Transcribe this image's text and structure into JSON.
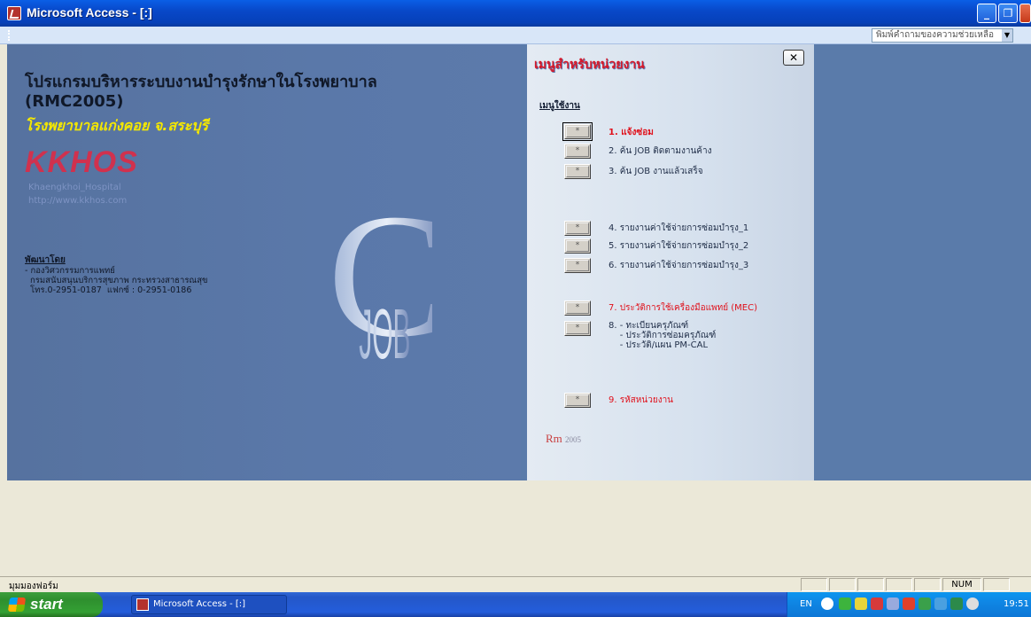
{
  "window": {
    "title": "Microsoft Access - [:]",
    "help_placeholder": "พิมพ์คำถามของความช่วยเหลือ",
    "minimize": "_",
    "maximize": "❐",
    "close": "✕"
  },
  "left": {
    "title_th": "โปรแกรมบริหารระบบงานบำรุงรักษาในโรงพยาบาล",
    "title_code": "(RMC2005)",
    "hospital": "โรงพยาบาลแก่งคอย จ.สระบุรี",
    "brand": "KKHOS",
    "brand_sub": "Khaengkhoi_Hospital",
    "brand_url": "http://www.kkhos.com",
    "dev_head": "พัฒนาโดย",
    "dev_lines": "- กองวิศวกรรมการแพทย์\n  กรมสนับสนุนบริการสุขภาพ กระทรวงสาธารณสุข\n  โทร.0-2951-0187  แฟกซ์ : 0-2951-0186",
    "cjob_letter": "C",
    "cjob_word": "JOB"
  },
  "menu": {
    "title": "เมนูสำหรับหน่วยงาน",
    "close": "✕",
    "subtitle": "เมนูใช้งาน",
    "button_glyph": "*",
    "items": [
      {
        "label": "1. แจ้งซ่อม"
      },
      {
        "label": "2. ค้น JOB ติดตามงานค้าง"
      },
      {
        "label": "3. ค้น JOB งานแล้วเสร็จ"
      },
      {
        "label": "4. รายงานค่าใช้จ่ายการซ่อมบำรุง_1"
      },
      {
        "label": "5. รายงานค่าใช้จ่ายการซ่อมบำรุง_2"
      },
      {
        "label": "6. รายงานค่าใช้จ่ายการซ่อมบำรุง_3"
      },
      {
        "label": "7. ประวัติการใช้เครื่องมือแพทย์ (MEC)"
      },
      {
        "label": "8. - ทะเบียนครุภัณฑ์\n    - ประวัติการซ่อมครุภัณฑ์\n    - ประวัติ/แผน PM-CAL"
      },
      {
        "label": "9. รหัสหน่วยงาน"
      }
    ],
    "logo_rm": "Rm",
    "logo_year": "2005"
  },
  "status": {
    "left": "มุมมองฟอร์ม",
    "num": "NUM"
  },
  "taskbar": {
    "start": "start",
    "item": "Microsoft Access - [:]",
    "lang": "EN",
    "clock": "19:51"
  }
}
